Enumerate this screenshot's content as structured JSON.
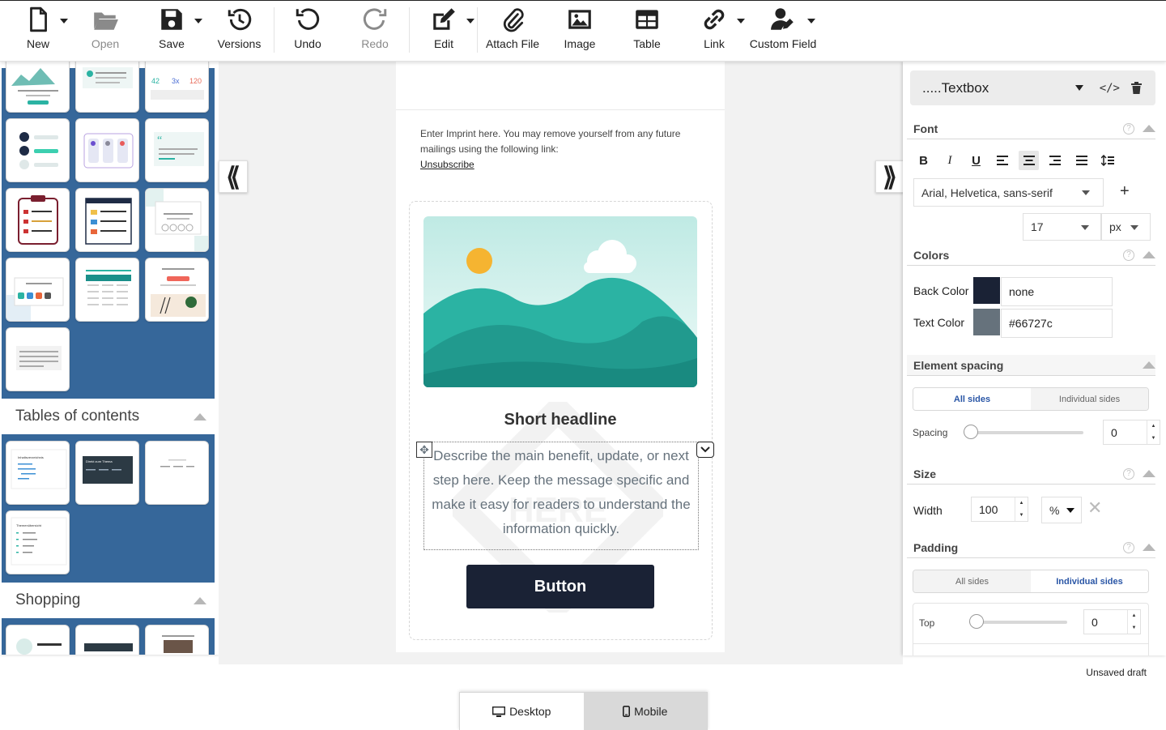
{
  "toolbar": {
    "new": "New",
    "open": "Open",
    "save": "Save",
    "versions": "Versions",
    "undo": "Undo",
    "redo": "Redo",
    "edit": "Edit",
    "attach_file": "Attach File",
    "image": "Image",
    "table": "Table",
    "link": "Link",
    "custom_field": "Custom Field"
  },
  "left_panel": {
    "categories": [
      {
        "title": "Tables of contents"
      },
      {
        "title": "Shopping"
      }
    ],
    "thumb_text": {
      "stat_1": "42",
      "stat_2": "3x",
      "stat_3": "120",
      "toc_title": "Inhaltsverzeichnis",
      "toc_dark_title": "Direkt zum Thema",
      "toc_topics_title": "Themenübersicht"
    }
  },
  "email": {
    "imprint_text": "Enter Imprint here. You may remove yourself from any future mailings using the following link:",
    "unsubscribe": "Unsubscribe",
    "headline": "Short headline",
    "body": "Describe the main benefit, update, or next step here. Keep the message specific and make it easy for readers to understand the information quickly.",
    "button": "Button",
    "watermark": "HERE"
  },
  "properties": {
    "selected_element": ".....Textbox",
    "sections": {
      "font": "Font",
      "colors": "Colors",
      "element_spacing": "Element spacing",
      "size": "Size",
      "padding": "Padding"
    },
    "font_family": "Arial, Helvetica, sans-serif",
    "font_size": "17",
    "font_unit": "px",
    "back_color_label": "Back Color",
    "back_color_value": "none",
    "text_color_label": "Text Color",
    "text_color_value": "#66727c",
    "spacing_all_sides": "All sides",
    "spacing_individual": "Individual sides",
    "spacing_label": "Spacing",
    "spacing_value": "0",
    "width_label": "Width",
    "width_value": "100",
    "width_unit": "%",
    "padding_all_sides": "All sides",
    "padding_individual": "Individual sides",
    "top_label": "Top",
    "top_value": "0"
  },
  "status": "Unsaved draft",
  "view": {
    "desktop": "Desktop",
    "mobile": "Mobile"
  },
  "colors": {
    "panel_blue": "#36679a",
    "button_dark": "#1a2235",
    "text_gray": "#66727c",
    "accent_blue": "#2a56a6",
    "teal": "#2bb3a3"
  }
}
